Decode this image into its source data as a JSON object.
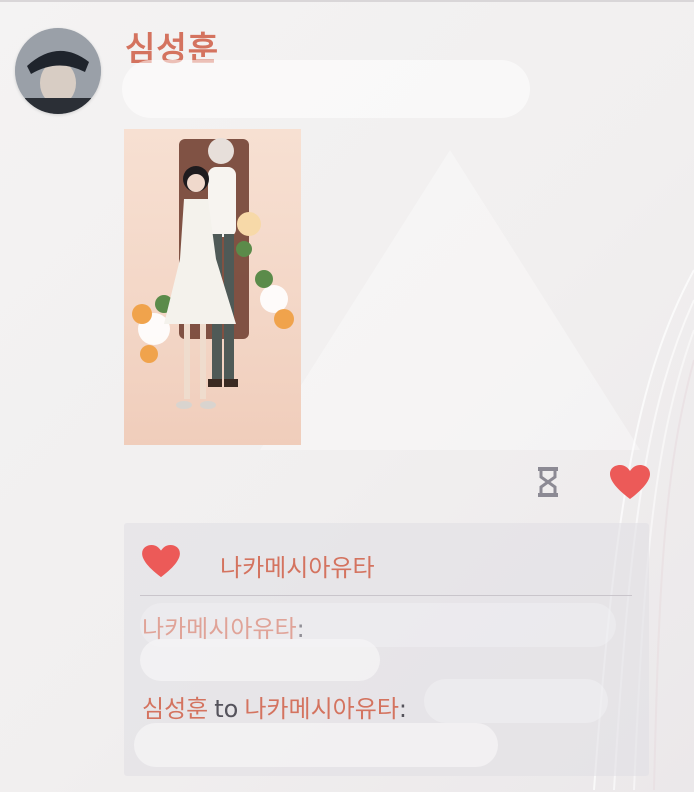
{
  "post": {
    "author": "심성훈"
  },
  "icons": {
    "hourglass": "hourglass-icon",
    "like": "heart-icon"
  },
  "colors": {
    "accent": "#d4735f",
    "like_red": "#ec5a58"
  },
  "likes": {
    "names": "나카메시아유타"
  },
  "comments": [
    {
      "from": "나카메시아유타",
      "colon": ":"
    },
    {
      "from": "심성훈",
      "to_word": "to",
      "to": "나카메시아유타",
      "colon": ":"
    }
  ]
}
